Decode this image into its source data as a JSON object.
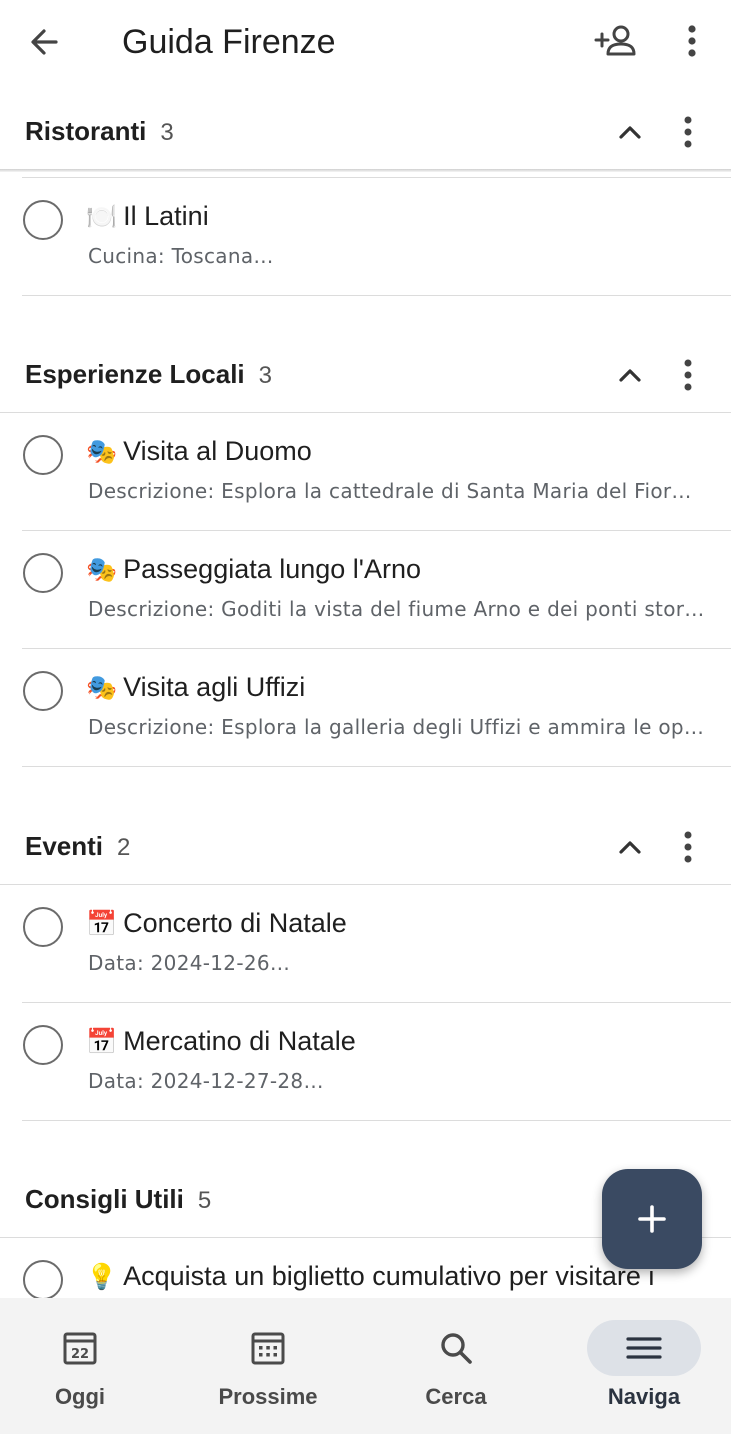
{
  "appbar": {
    "title": "Guida Firenze"
  },
  "sections": [
    {
      "name": "Ristoranti",
      "count": "3",
      "tasks": [
        {
          "emoji": "🍽️",
          "title": "Il Latini",
          "desc": "Cucina: Toscana…"
        }
      ]
    },
    {
      "name": "Esperienze Locali",
      "count": "3",
      "tasks": [
        {
          "emoji": "🎭",
          "title": "Visita al Duomo",
          "desc": "Descrizione: Esplora la cattedrale di Santa Maria del Fior…"
        },
        {
          "emoji": "🎭",
          "title": "Passeggiata lungo l'Arno",
          "desc": "Descrizione: Goditi la vista del fiume Arno e dei ponti stor…"
        },
        {
          "emoji": "🎭",
          "title": "Visita agli Uffizi",
          "desc": "Descrizione: Esplora la galleria degli Uffizi e ammira le op…"
        }
      ]
    },
    {
      "name": "Eventi",
      "count": "2",
      "tasks": [
        {
          "emoji": "📅",
          "title": "Concerto di Natale",
          "desc": "Data: 2024-12-26…"
        },
        {
          "emoji": "📅",
          "title": "Mercatino di Natale",
          "desc": "Data: 2024-12-27-28…"
        }
      ]
    },
    {
      "name": "Consigli Utili",
      "count": "5",
      "tasks": [
        {
          "emoji": "💡",
          "title": "Acquista un biglietto cumulativo per visitare i"
        }
      ]
    }
  ],
  "bottomnav": {
    "items": [
      {
        "label": "Oggi",
        "icon": "calendar-today-icon",
        "day": "22"
      },
      {
        "label": "Prossime",
        "icon": "calendar-grid-icon"
      },
      {
        "label": "Cerca",
        "icon": "search-icon"
      },
      {
        "label": "Naviga",
        "icon": "menu-icon",
        "active": true
      }
    ]
  }
}
